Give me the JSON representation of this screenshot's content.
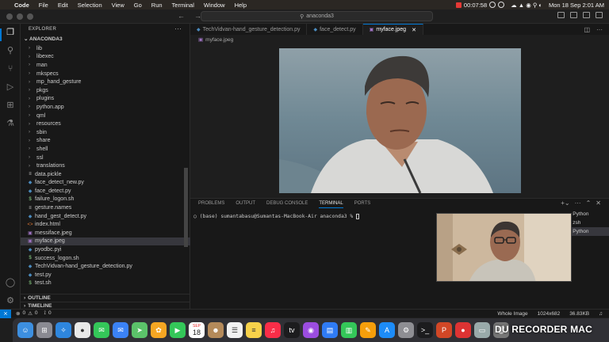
{
  "menubar": {
    "apple": "",
    "app": "Code",
    "items": [
      "File",
      "Edit",
      "Selection",
      "View",
      "Go",
      "Run",
      "Terminal",
      "Window",
      "Help"
    ],
    "timer": "00:07:58",
    "datetime": "Mon 18 Sep  2:01 AM"
  },
  "titlebar": {
    "back": "←",
    "forward": "→",
    "search": "anaconda3"
  },
  "sidebar": {
    "title": "EXPLORER",
    "root": "ANACONDA3",
    "items": [
      {
        "name": "lib",
        "type": "folder"
      },
      {
        "name": "libexec",
        "type": "folder"
      },
      {
        "name": "man",
        "type": "folder"
      },
      {
        "name": "mkspecs",
        "type": "folder"
      },
      {
        "name": "mp_hand_gesture",
        "type": "folder"
      },
      {
        "name": "pkgs",
        "type": "folder"
      },
      {
        "name": "plugins",
        "type": "folder"
      },
      {
        "name": "python.app",
        "type": "folder"
      },
      {
        "name": "qml",
        "type": "folder"
      },
      {
        "name": "resources",
        "type": "folder"
      },
      {
        "name": "sbin",
        "type": "folder"
      },
      {
        "name": "share",
        "type": "folder"
      },
      {
        "name": "shell",
        "type": "folder"
      },
      {
        "name": "ssl",
        "type": "folder"
      },
      {
        "name": "translations",
        "type": "folder"
      },
      {
        "name": "data.pickle",
        "type": "file",
        "icon": "≡",
        "color": "#cccccc"
      },
      {
        "name": "face_detect_new.py",
        "type": "file",
        "icon": "◆",
        "color": "#4b8bbe"
      },
      {
        "name": "face_detect.py",
        "type": "file",
        "icon": "◆",
        "color": "#4b8bbe"
      },
      {
        "name": "failure_logon.sh",
        "type": "file",
        "icon": "$",
        "color": "#89d185"
      },
      {
        "name": "gesture.names",
        "type": "file",
        "icon": "≡",
        "color": "#cccccc"
      },
      {
        "name": "hand_gest_detect.py",
        "type": "file",
        "icon": "◆",
        "color": "#4b8bbe"
      },
      {
        "name": "index.html",
        "type": "file",
        "icon": "<>",
        "color": "#e37933"
      },
      {
        "name": "messiface.jpeg",
        "type": "file",
        "icon": "▣",
        "color": "#a074c4"
      },
      {
        "name": "myface.jpeg",
        "type": "file",
        "icon": "▣",
        "color": "#a074c4",
        "selected": true
      },
      {
        "name": "pyodbc.pyi",
        "type": "file",
        "icon": "◆",
        "color": "#4b8bbe"
      },
      {
        "name": "success_logon.sh",
        "type": "file",
        "icon": "$",
        "color": "#89d185"
      },
      {
        "name": "TechVidvan-hand_gesture_detection.py",
        "type": "file",
        "icon": "◆",
        "color": "#4b8bbe"
      },
      {
        "name": "test.py",
        "type": "file",
        "icon": "◆",
        "color": "#4b8bbe"
      },
      {
        "name": "test.sh",
        "type": "file",
        "icon": "$",
        "color": "#89d185"
      }
    ],
    "outline": "OUTLINE",
    "timeline": "TIMELINE"
  },
  "tabs": [
    {
      "label": "TechVidvan-hand_gesture_detection.py",
      "icon": "◆",
      "color": "#4b8bbe"
    },
    {
      "label": "face_detect.py",
      "icon": "◆",
      "color": "#4b8bbe"
    },
    {
      "label": "myface.jpeg",
      "icon": "▣",
      "color": "#a074c4",
      "active": true,
      "close": "✕"
    }
  ],
  "breadcrumb": "myface.jpeg",
  "panel": {
    "tabs": [
      "PROBLEMS",
      "OUTPUT",
      "DEBUG CONSOLE",
      "TERMINAL",
      "PORTS"
    ],
    "active_tab": "TERMINAL",
    "prompt": "(base) sumantabasu@Sumantas-MacBook-Air anaconda3 % ",
    "terminals": [
      "Python",
      "zsh",
      "Python"
    ]
  },
  "statusbar": {
    "errors": "0",
    "warnings": "0",
    "ports": "0",
    "image_mode": "Whole Image",
    "dimensions": "1024x682",
    "size": "36.83KB"
  },
  "dock": {
    "calendar_month": "SEP",
    "calendar_day": "18",
    "watermark": "DU RECORDER MAC"
  }
}
